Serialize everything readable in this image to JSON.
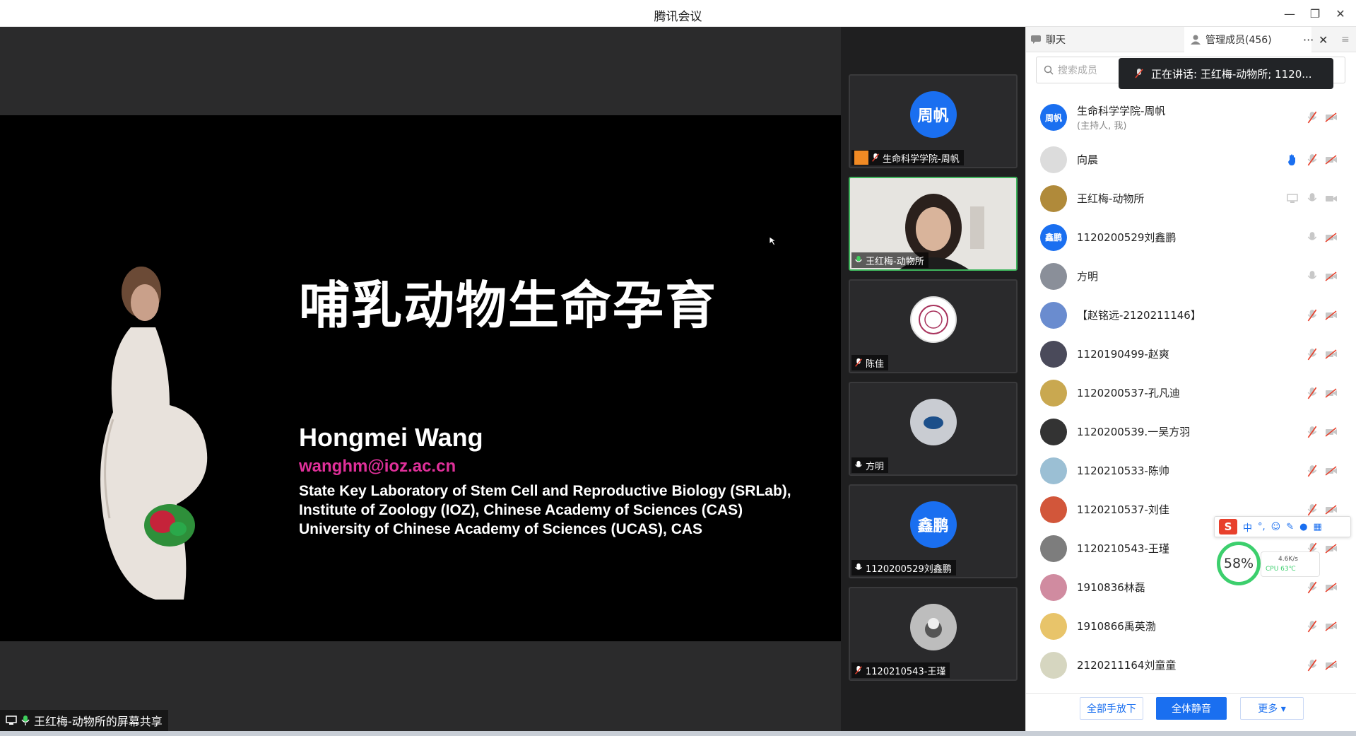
{
  "window": {
    "title": "腾讯会议"
  },
  "slide": {
    "title": "哺乳动物生命孕育",
    "author": "Hongmei Wang",
    "email": "wanghm@ioz.ac.cn",
    "affiliations": [
      "State Key Laboratory of Stem Cell and Reproductive Biology (SRLab),",
      "Institute of Zoology (IOZ), Chinese Academy of Sciences (CAS)",
      "University of Chinese Academy of Sciences (UCAS), CAS"
    ]
  },
  "share_label": "王红梅-动物所的屏幕共享",
  "video_tiles": [
    {
      "name": "生命科学学院-周帆",
      "avatar_text": "周帆"
    },
    {
      "name": "王红梅-动物所",
      "avatar_text": ""
    },
    {
      "name": "陈佳",
      "avatar_text": ""
    },
    {
      "name": "方明",
      "avatar_text": ""
    },
    {
      "name": "1120200529刘鑫鹏",
      "avatar_text": "鑫鹏"
    },
    {
      "name": "1120210543-王瑾",
      "avatar_text": ""
    }
  ],
  "panel": {
    "tab_chat": "聊天",
    "tab_members": "管理成员(456)",
    "search_placeholder": "搜索成员",
    "speaking": "正在讲话: 王红梅-动物所; 1120...",
    "members": [
      {
        "name": "生命科学学院-周帆",
        "sub": "(主持人, 我)",
        "avatar_text": "周帆",
        "color": "#1a6ff0"
      },
      {
        "name": "向晨",
        "sub": "",
        "avatar_text": "",
        "color": "#dcdcdc"
      },
      {
        "name": "王红梅-动物所",
        "sub": "",
        "avatar_text": "",
        "color": "#b08a3a"
      },
      {
        "name": "1120200529刘鑫鹏",
        "sub": "",
        "avatar_text": "鑫鹏",
        "color": "#1a6ff0"
      },
      {
        "name": "方明",
        "sub": "",
        "avatar_text": "",
        "color": "#8a8f99"
      },
      {
        "name": "【赵铭远-2120211146】",
        "sub": "",
        "avatar_text": "",
        "color": "#6a8ccf"
      },
      {
        "name": "1120190499-赵爽",
        "sub": "",
        "avatar_text": "",
        "color": "#4a4a5a"
      },
      {
        "name": "1120200537-孔凡迪",
        "sub": "",
        "avatar_text": "",
        "color": "#c9a850"
      },
      {
        "name": "1120200539.一吴方羽",
        "sub": "",
        "avatar_text": "",
        "color": "#333333"
      },
      {
        "name": "1120210533-陈帅",
        "sub": "",
        "avatar_text": "",
        "color": "#9bbfd4"
      },
      {
        "name": "1120210537-刘佳",
        "sub": "",
        "avatar_text": "",
        "color": "#d2563a"
      },
      {
        "name": "1120210543-王瑾",
        "sub": "",
        "avatar_text": "",
        "color": "#7d7d7d"
      },
      {
        "name": "1910836林磊",
        "sub": "",
        "avatar_text": "",
        "color": "#d08ba0"
      },
      {
        "name": "1910866禹英渤",
        "sub": "",
        "avatar_text": "",
        "color": "#e8c46a"
      },
      {
        "name": "2120211164刘童童",
        "sub": "",
        "avatar_text": "",
        "color": "#d6d6c0"
      }
    ],
    "footer": {
      "lower_hands": "全部手放下",
      "mute_all": "全体静音",
      "more": "更多 ▾"
    }
  },
  "ime": {
    "lang": "中"
  },
  "perf": {
    "percent": "58%",
    "net": "4.6K/s",
    "cpu": "CPU 63℃"
  }
}
